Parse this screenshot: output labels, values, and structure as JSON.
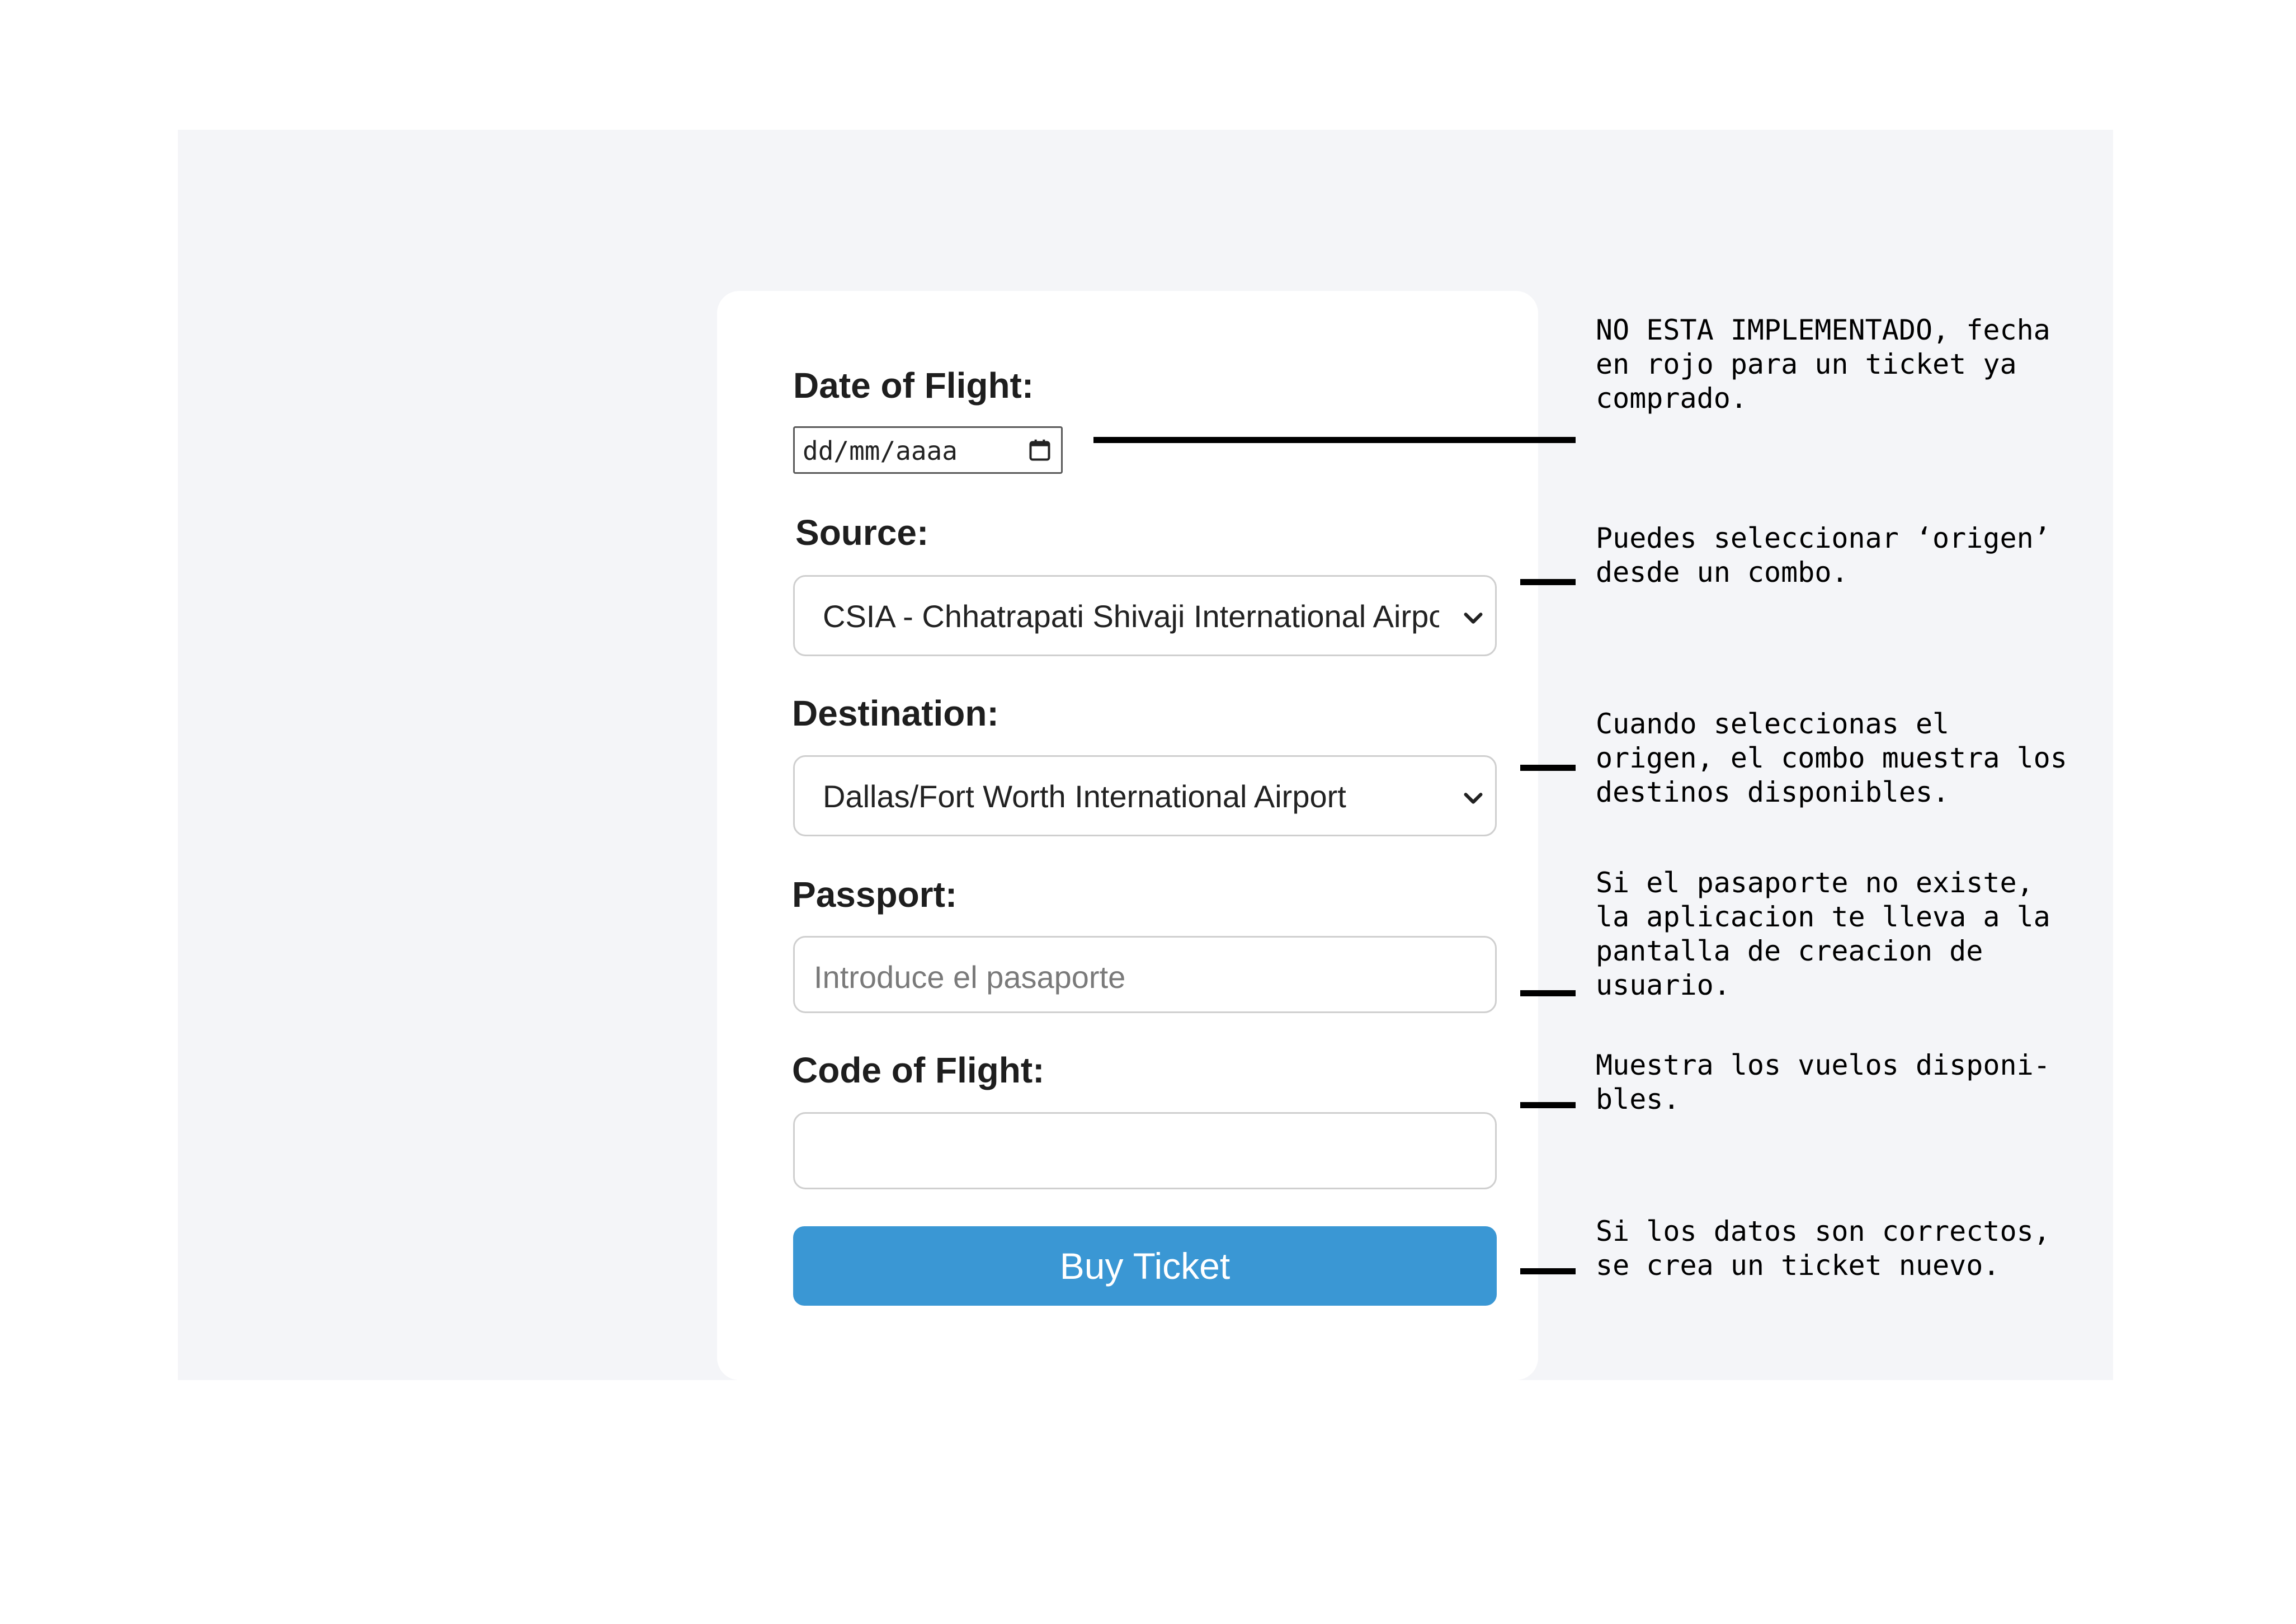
{
  "form": {
    "date_label": "Date of Flight:",
    "date_placeholder": "dd/mm/aaaa",
    "source_label": "Source:",
    "source_value": "CSIA - Chhatrapati Shivaji International Airport",
    "destination_label": "Destination:",
    "destination_value": "Dallas/Fort Worth International Airport",
    "passport_label": "Passport:",
    "passport_placeholder": "Introduce el pasaporte",
    "code_label": "Code of Flight:",
    "code_value": "",
    "buy_label": "Buy Ticket"
  },
  "annotations": [
    "NO ESTA IMPLEMENTADO, fecha\nen rojo para un ticket ya\ncomprado.",
    "Puedes seleccionar ‘origen’\ndesde un combo.",
    "Cuando seleccionas el\norigen, el combo muestra los\ndestinos disponibles.",
    "Si el pasaporte no existe,\nla aplicacion te lleva a la\npantalla de creacion de\nusuario.",
    "Muestra los vuelos disponi-\nbles.",
    "Si los datos son correctos,\nse crea un ticket nuevo."
  ],
  "colors": {
    "backdrop": "#f4f5f8",
    "button": "#3a97d4",
    "border": "#cfcfcf"
  },
  "icons": {
    "date_picker": "calendar-icon",
    "select_arrow": "chevron-down-icon"
  }
}
